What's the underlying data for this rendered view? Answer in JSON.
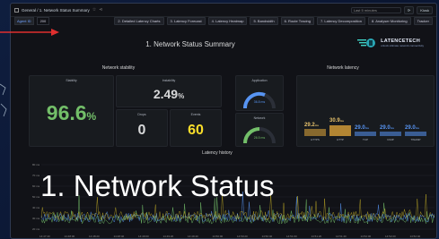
{
  "topbar": {
    "breadcrumb": "General / 1. Network Status Summary",
    "search_placeholder": "Last 5 minutes",
    "kiosk": "Kiosk"
  },
  "variables": {
    "label": "Agent ID",
    "value": "200",
    "links": [
      "2. Detailed Latency Charts",
      "3. Latency Forecast",
      "4. Latency Heatmap",
      "5. Bandwidth",
      "6. Route Tracing",
      "7. Latency Decomposition",
      "8. Analyser Monitoring",
      "Tracker"
    ]
  },
  "page_title": "1. Network Status Summary",
  "logo": {
    "name": "LATENCETECH",
    "tagline": "unlock ultimate network connectivity"
  },
  "stability": {
    "section_title": "Network stability",
    "stability_label": "Stability",
    "stability_value": "96.6",
    "stability_unit": "%",
    "instability_label": "Instability",
    "instability_value": "2.49",
    "instability_unit": "%",
    "drops_label": "Drops",
    "drops_value": "0",
    "events_label": "Events",
    "events_value": "60"
  },
  "gauges": {
    "application_label": "Application",
    "application_value": "36.8 ms",
    "network_label": "Network",
    "network_value": "26.5 ms"
  },
  "latency": {
    "section_title": "Network latency",
    "bars": [
      {
        "label": "HTTPS",
        "value": "29.2",
        "unit": "ms"
      },
      {
        "label": "HTTP",
        "value": "30.9",
        "unit": "ms"
      },
      {
        "label": "TCP",
        "value": "29.0",
        "unit": "ms"
      },
      {
        "label": "ICMP",
        "value": "29.0",
        "unit": "ms"
      },
      {
        "label": "TWAMP",
        "value": "29.0",
        "unit": "ms"
      }
    ]
  },
  "history": {
    "title": "Latency history",
    "y_ticks": [
      "80 ms",
      "70 ms",
      "60 ms",
      "50 ms",
      "40 ms",
      "30 ms",
      "20 ms"
    ],
    "x_ticks": [
      "14:47:40",
      "14:48:00",
      "14:48:20",
      "14:48:40",
      "14:49:00",
      "14:49:20",
      "14:49:40",
      "14:50:00",
      "14:50:20",
      "14:50:40",
      "14:51:00",
      "14:51:20",
      "14:51:40",
      "14:52:00",
      "14:52:20",
      "14:52:40"
    ]
  },
  "caption": "1. Network Status",
  "colors": {
    "green": "#73bf69",
    "yellow": "#fade2a",
    "orange": "#e5a93b",
    "blue": "#5794f2",
    "red_arrow": "#e02f2f"
  }
}
